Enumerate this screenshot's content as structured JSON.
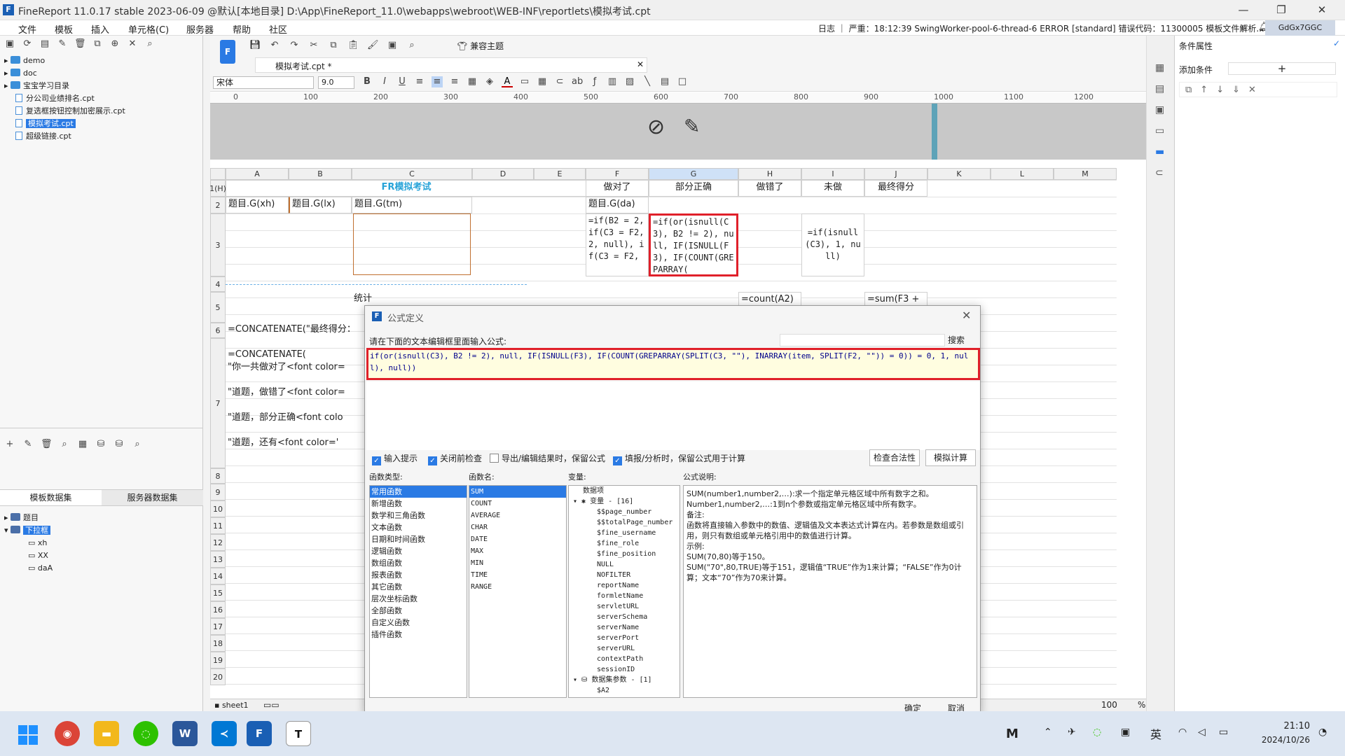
{
  "window": {
    "title": "FineReport 11.0.17 stable 2023-06-09 @默认[本地目录]    D:\\App\\FineReport_11.0\\webapps\\webroot\\WEB-INF\\reportlets\\模拟考试.cpt",
    "logo": "F",
    "minimize": "—",
    "maximize": "❐",
    "close": "✕"
  },
  "menu": [
    "文件",
    "模板",
    "插入",
    "单元格(C)",
    "服务器",
    "帮助",
    "社区"
  ],
  "log": {
    "text": "日志 ｜ 严重：18:12:39 SwingWorker-pool-6-thread-6 ERROR [standard] 错误代码：11300005 模板文件解析...",
    "user": "GdGx7GGC"
  },
  "tree": [
    {
      "name": "demo",
      "type": "folder"
    },
    {
      "name": "doc",
      "type": "folder"
    },
    {
      "name": "宝宝学习目录",
      "type": "folder"
    },
    {
      "name": "分公司业绩排名.cpt",
      "type": "file"
    },
    {
      "name": "复选框按钮控制加密展示.cpt",
      "type": "file"
    },
    {
      "name": "模拟考试.cpt",
      "type": "file",
      "selected": true
    },
    {
      "name": "超级链接.cpt",
      "type": "file"
    }
  ],
  "datasets": {
    "tab_template": "模板数据集",
    "tab_server": "服务器数据集",
    "items": [
      "题目",
      "下拉框"
    ],
    "fields": [
      "xh",
      "XX",
      "daA"
    ]
  },
  "ribbon": {
    "compat_theme": "兼容主题",
    "doc_tab": "模拟考试.cpt *",
    "font": "宋体",
    "size": "9.0"
  },
  "ruler": [
    "0",
    "100",
    "200",
    "300",
    "400",
    "500",
    "600",
    "700",
    "800",
    "900",
    "1000",
    "1100",
    "1200"
  ],
  "columns": [
    "A",
    "B",
    "C",
    "D",
    "E",
    "F",
    "G",
    "H",
    "I",
    "J",
    "K",
    "L",
    "M"
  ],
  "rows": [
    "1(H)",
    "2",
    "3",
    "4",
    "5",
    "6",
    "7",
    "8",
    "9",
    "10",
    "11",
    "12",
    "13",
    "14",
    "15",
    "16",
    "17",
    "18",
    "19",
    "20"
  ],
  "cells": {
    "title": "FR模拟考试",
    "f1": "做对了",
    "g1": "部分正确",
    "h1": "做错了",
    "i1": "未做",
    "j1": "最终得分",
    "a2": "题目.G(xh)",
    "b2": "题目.G(lx)",
    "c2": "题目.G(tm)",
    "f2": "题目.G(da)",
    "f3": "=if(B2 = 2, if(C3 = F2, 2, null), if(C3 = F2,",
    "g3": "=if(or(isnull(C3), B2 != 2), null, IF(ISNULL(F3), IF(COUNT(GREPARRAY(",
    "i3": "=if(isnull(C3), 1, null)",
    "c5": "统计",
    "h5": "=count(A2)",
    "j5": "=sum(F3 +",
    "a6": "=CONCATENATE(\"最终得分：",
    "a7": "=CONCATENATE(\n\"你一共做对了<font color=\n\n\"道题，做错了<font color=\n\n\"道题，部分正确<font colo\n\n\"道题，还有<font color='"
  },
  "dialog": {
    "title": "公式定义",
    "prompt": "请在下面的文本编辑框里面输入公式:",
    "search": "搜索",
    "formula": "if(or(isnull(C3), B2 != 2), null, IF(ISNULL(F3), IF(COUNT(GREPARRAY(SPLIT(C3, \"\"), INARRAY(item, SPLIT(F2, \"\")) = 0)) = 0, 1, null), null))",
    "options": [
      {
        "label": "输入提示",
        "checked": true
      },
      {
        "label": "关闭前检查",
        "checked": true
      },
      {
        "label": "导出/编辑结果时，保留公式",
        "checked": false
      },
      {
        "label": "填报/分析时，保留公式用于计算",
        "checked": true
      }
    ],
    "check_btn": "检查合法性",
    "simulate_btn": "模拟计算",
    "func_type_label": "函数类型:",
    "func_name_label": "函数名:",
    "var_label": "变量:",
    "desc_label": "公式说明:",
    "func_types": [
      "常用函数",
      "新增函数",
      "数学和三角函数",
      "文本函数",
      "日期和时间函数",
      "逻辑函数",
      "数组函数",
      "报表函数",
      "其它函数",
      "层次坐标函数",
      "全部函数",
      "自定义函数",
      "插件函数"
    ],
    "func_names": [
      "SUM",
      "COUNT",
      "AVERAGE",
      "CHAR",
      "DATE",
      "MAX",
      "MIN",
      "TIME",
      "RANGE"
    ],
    "variables": [
      "数据项",
      "变量 - [16]",
      "$$page_number",
      "$$totalPage_number",
      "$fine_username",
      "$fine_role",
      "$fine_position",
      "NULL",
      "NOFILTER",
      "reportName",
      "formletName",
      "servletURL",
      "serverSchema",
      "serverName",
      "serverPort",
      "serverURL",
      "contextPath",
      "sessionID",
      "数据集参数 - [1]",
      "$A2"
    ],
    "description": "SUM(number1,number2,…):求一个指定单元格区域中所有数字之和。\nNumber1,number2,…:1到n个参数或指定单元格区域中所有数字。\n备注:\n函数将直接输入参数中的数值、逻辑值及文本表达式计算在内。若参数是数组或引用，则只有数组或单元格引用中的数值进行计算。\n示例:\nSUM(70,80)等于150。\nSUM(\"70\",80,TRUE)等于151，逻辑值“TRUE”作为1来计算；“FALSE”作为0计算；文本“70”作为70来计算。",
    "ok": "确定",
    "cancel": "取消"
  },
  "right": {
    "title": "条件属性",
    "add_condition": "添加条件",
    "plus": "+"
  },
  "status": {
    "sheet": "sheet1",
    "zoom": "100",
    "percent": "%"
  },
  "taskbar": {
    "time": "21:10",
    "date": "2024/10/26",
    "ime": "英"
  }
}
